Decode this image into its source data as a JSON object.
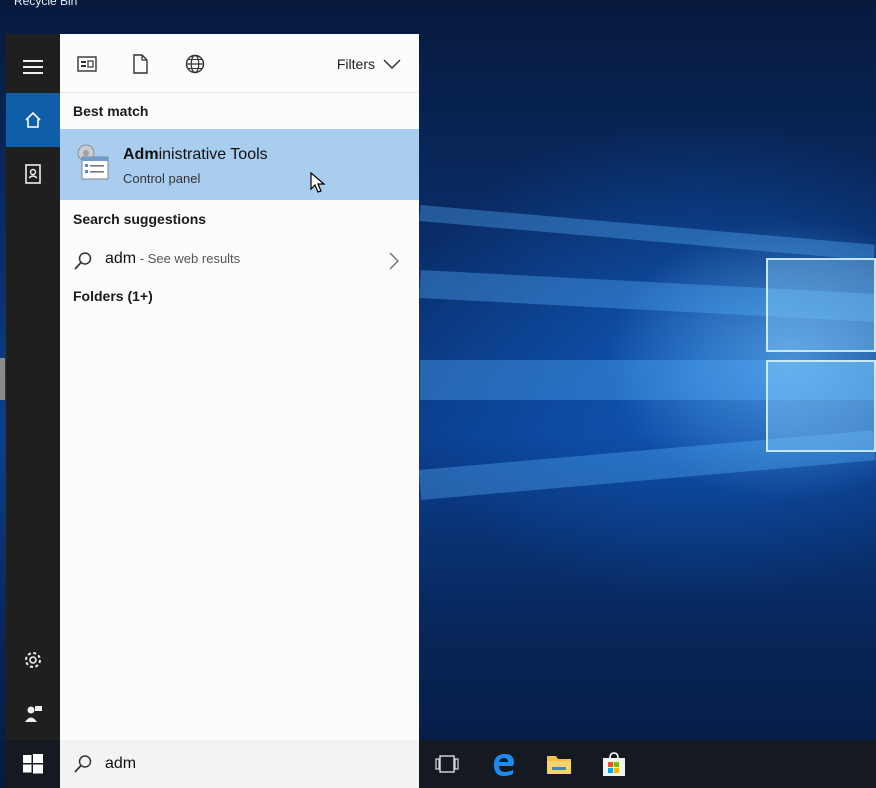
{
  "desktop": {
    "top_label": "Recycle Bin"
  },
  "toolbar": {
    "icons": [
      "apps-icon",
      "document-icon",
      "web-icon"
    ],
    "filters_label": "Filters"
  },
  "sections": {
    "best_match": "Best match",
    "search_suggestions": "Search suggestions",
    "folders": "Folders (1+)"
  },
  "best_match": {
    "title_bold": "Adm",
    "title_rest": "inistrative Tools",
    "subtitle": "Control panel"
  },
  "suggestion": {
    "query": "adm",
    "hint": " - See web results"
  },
  "search": {
    "value": "adm"
  },
  "rail": {
    "icons": [
      "hamburger-menu-icon",
      "home-icon",
      "notebook-icon",
      "settings-icon",
      "feedback-icon"
    ]
  },
  "taskbar": {
    "icons": [
      "start-windows-icon",
      "task-view-icon",
      "edge-browser-icon",
      "file-explorer-icon",
      "store-icon"
    ]
  }
}
